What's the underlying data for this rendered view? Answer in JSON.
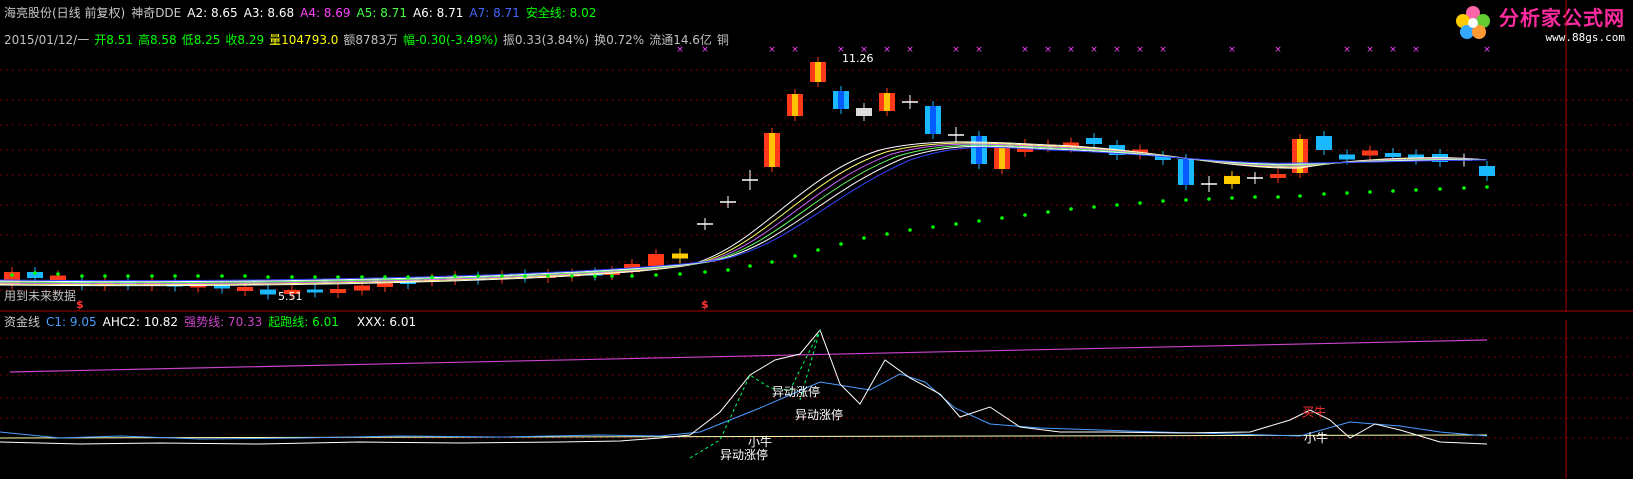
{
  "header": {
    "stock_name": "海亮股份(日线 前复权)",
    "indicator": "神奇DDE",
    "a2": "A2: 8.65",
    "a3": "A3: 8.68",
    "a4": "A4: 8.69",
    "a5": "A5: 8.71",
    "a6": "A6: 8.71",
    "a7": "A7: 8.71",
    "safe_line": "安全线: 8.02"
  },
  "quote": {
    "date": "2015/01/12/一",
    "open": "开8.51",
    "high": "高8.58",
    "low": "低8.25",
    "close": "收8.29",
    "volume": "量104793.0",
    "amount": "额8783万",
    "change": "幅-0.30(-3.49%)",
    "amplitude": "振0.33(3.84%)",
    "turnover": "换0.72%",
    "float": "流通14.6亿",
    "sector": "铜"
  },
  "main": {
    "future_warning": "用到未来数据",
    "high_mark": "11.26",
    "low_mark": "5.51",
    "dollar_mark": "$"
  },
  "sub": {
    "name": "资金线",
    "c1": "C1: 9.05",
    "ahc2": "AHC2: 10.82",
    "strong": "强势线: 70.33",
    "start": "起跑线: 6.01",
    "xxx": "XXX: 6.01",
    "ann_limit_up": "异动涨停",
    "ann_bull": "小牛",
    "ann_buy": "买牛"
  },
  "logo": {
    "title": "分析家公式网",
    "url": "www.88gs.com"
  },
  "colors": {
    "up": "#ff3333",
    "down": "#00e5ff",
    "safe": "#00ff00",
    "purple": "#cc44cc",
    "white": "#ffffff"
  }
}
